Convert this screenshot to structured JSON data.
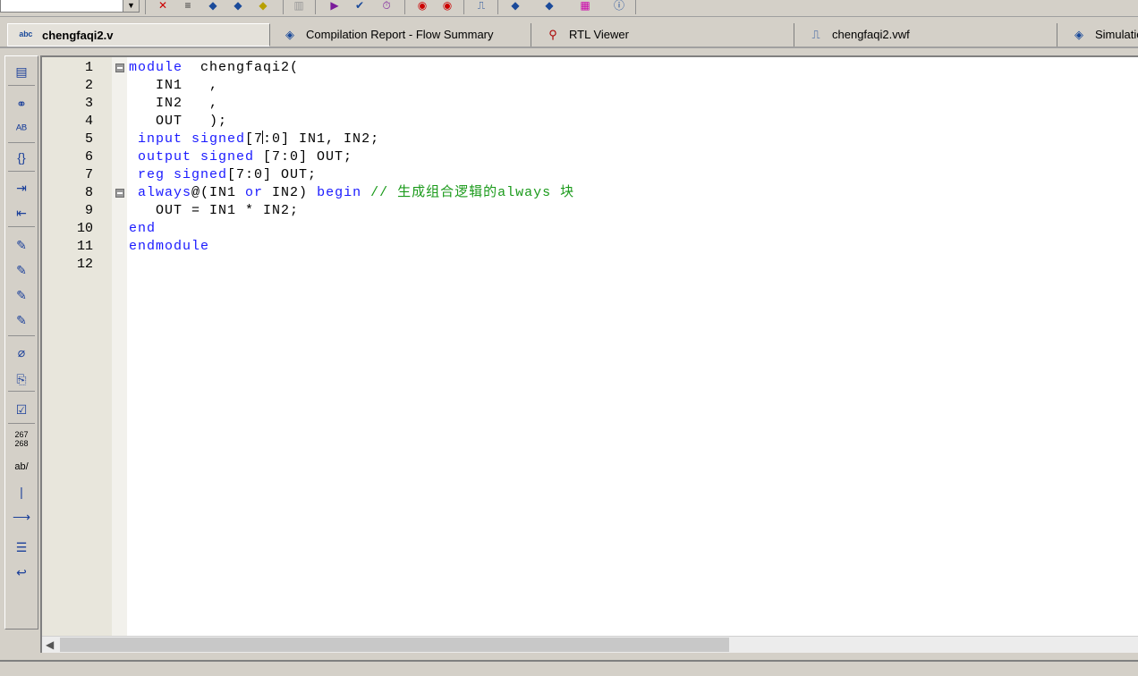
{
  "toolbar": {
    "icons": [
      "chip-planner-icon",
      "pin-planner-icon",
      "assignment-icon",
      "settings-icon",
      "compile-icon",
      "stop-icon",
      "start-analysis-icon",
      "start-compilation-icon",
      "timing-analyzer-icon",
      "programmer-icon",
      "signaltap-icon",
      "simulation-icon",
      "rtl-viewer-icon",
      "technology-map-icon",
      "netlist-icon",
      "help-icon"
    ]
  },
  "tabs": [
    {
      "label": "chengfaqi2.v",
      "icon": "verilog-file-icon",
      "active": true
    },
    {
      "label": "Compilation Report - Flow Summary",
      "icon": "report-icon"
    },
    {
      "label": "RTL Viewer",
      "icon": "rtl-viewer-icon"
    },
    {
      "label": "chengfaqi2.vwf",
      "icon": "waveform-icon"
    },
    {
      "label": "Simulatio",
      "icon": "simulation-report-icon"
    }
  ],
  "sidebar": {
    "icons": [
      "insert-template-icon",
      "find-icon",
      "replace-icon",
      "braces-icon",
      "indent-icon",
      "unindent-icon",
      "bookmark-icon",
      "next-bookmark-icon",
      "previous-bookmark-icon",
      "clear-bookmarks-icon",
      "attach-icon",
      "scroll-icon",
      "check-icon",
      "line-numbers-icon",
      "spell-icon",
      "vertical-line-icon",
      "whitespace-icon",
      "list-icon",
      "wrap-icon"
    ],
    "line_numbers_label": "267 268",
    "ab_label": "ab/"
  },
  "editor": {
    "lines": [
      {
        "n": "1",
        "fold": true,
        "tokens": [
          [
            "kw",
            "module"
          ],
          [
            "",
            "  chengfaqi2("
          ]
        ]
      },
      {
        "n": "2",
        "tokens": [
          [
            "",
            "   IN1   ,"
          ]
        ]
      },
      {
        "n": "3",
        "tokens": [
          [
            "",
            "   IN2   ,"
          ]
        ]
      },
      {
        "n": "4",
        "tokens": [
          [
            "",
            "   OUT   );"
          ]
        ]
      },
      {
        "n": "5",
        "tokens": [
          [
            "kw",
            " input signed"
          ],
          [
            "",
            "[7"
          ],
          [
            "cursor",
            ""
          ],
          [
            "",
            ":0] IN1, IN2;"
          ]
        ]
      },
      {
        "n": "6",
        "tokens": [
          [
            "kw",
            " output signed"
          ],
          [
            "",
            " [7:0] OUT;"
          ]
        ]
      },
      {
        "n": "7",
        "tokens": [
          [
            "kw",
            " reg signed"
          ],
          [
            "",
            "[7:0] OUT;"
          ]
        ]
      },
      {
        "n": "8",
        "fold": true,
        "tokens": [
          [
            "kw",
            " always"
          ],
          [
            "",
            "@(IN1 "
          ],
          [
            "kw",
            "or"
          ],
          [
            "",
            " IN2) "
          ],
          [
            "kw",
            "begin"
          ],
          [
            "cm",
            " // 生成组合逻辑的always 块"
          ]
        ]
      },
      {
        "n": "9",
        "tokens": [
          [
            "",
            "   OUT = IN1 * IN2;"
          ]
        ]
      },
      {
        "n": "10",
        "tokens": [
          [
            "kw",
            "end"
          ]
        ]
      },
      {
        "n": "11",
        "tokens": [
          [
            "kw",
            "endmodule"
          ]
        ]
      },
      {
        "n": "12",
        "tokens": []
      }
    ]
  },
  "colors": {
    "keyword": "#1a1aff",
    "comment": "#1a9a1a",
    "gutter": "#e8e6dc"
  }
}
